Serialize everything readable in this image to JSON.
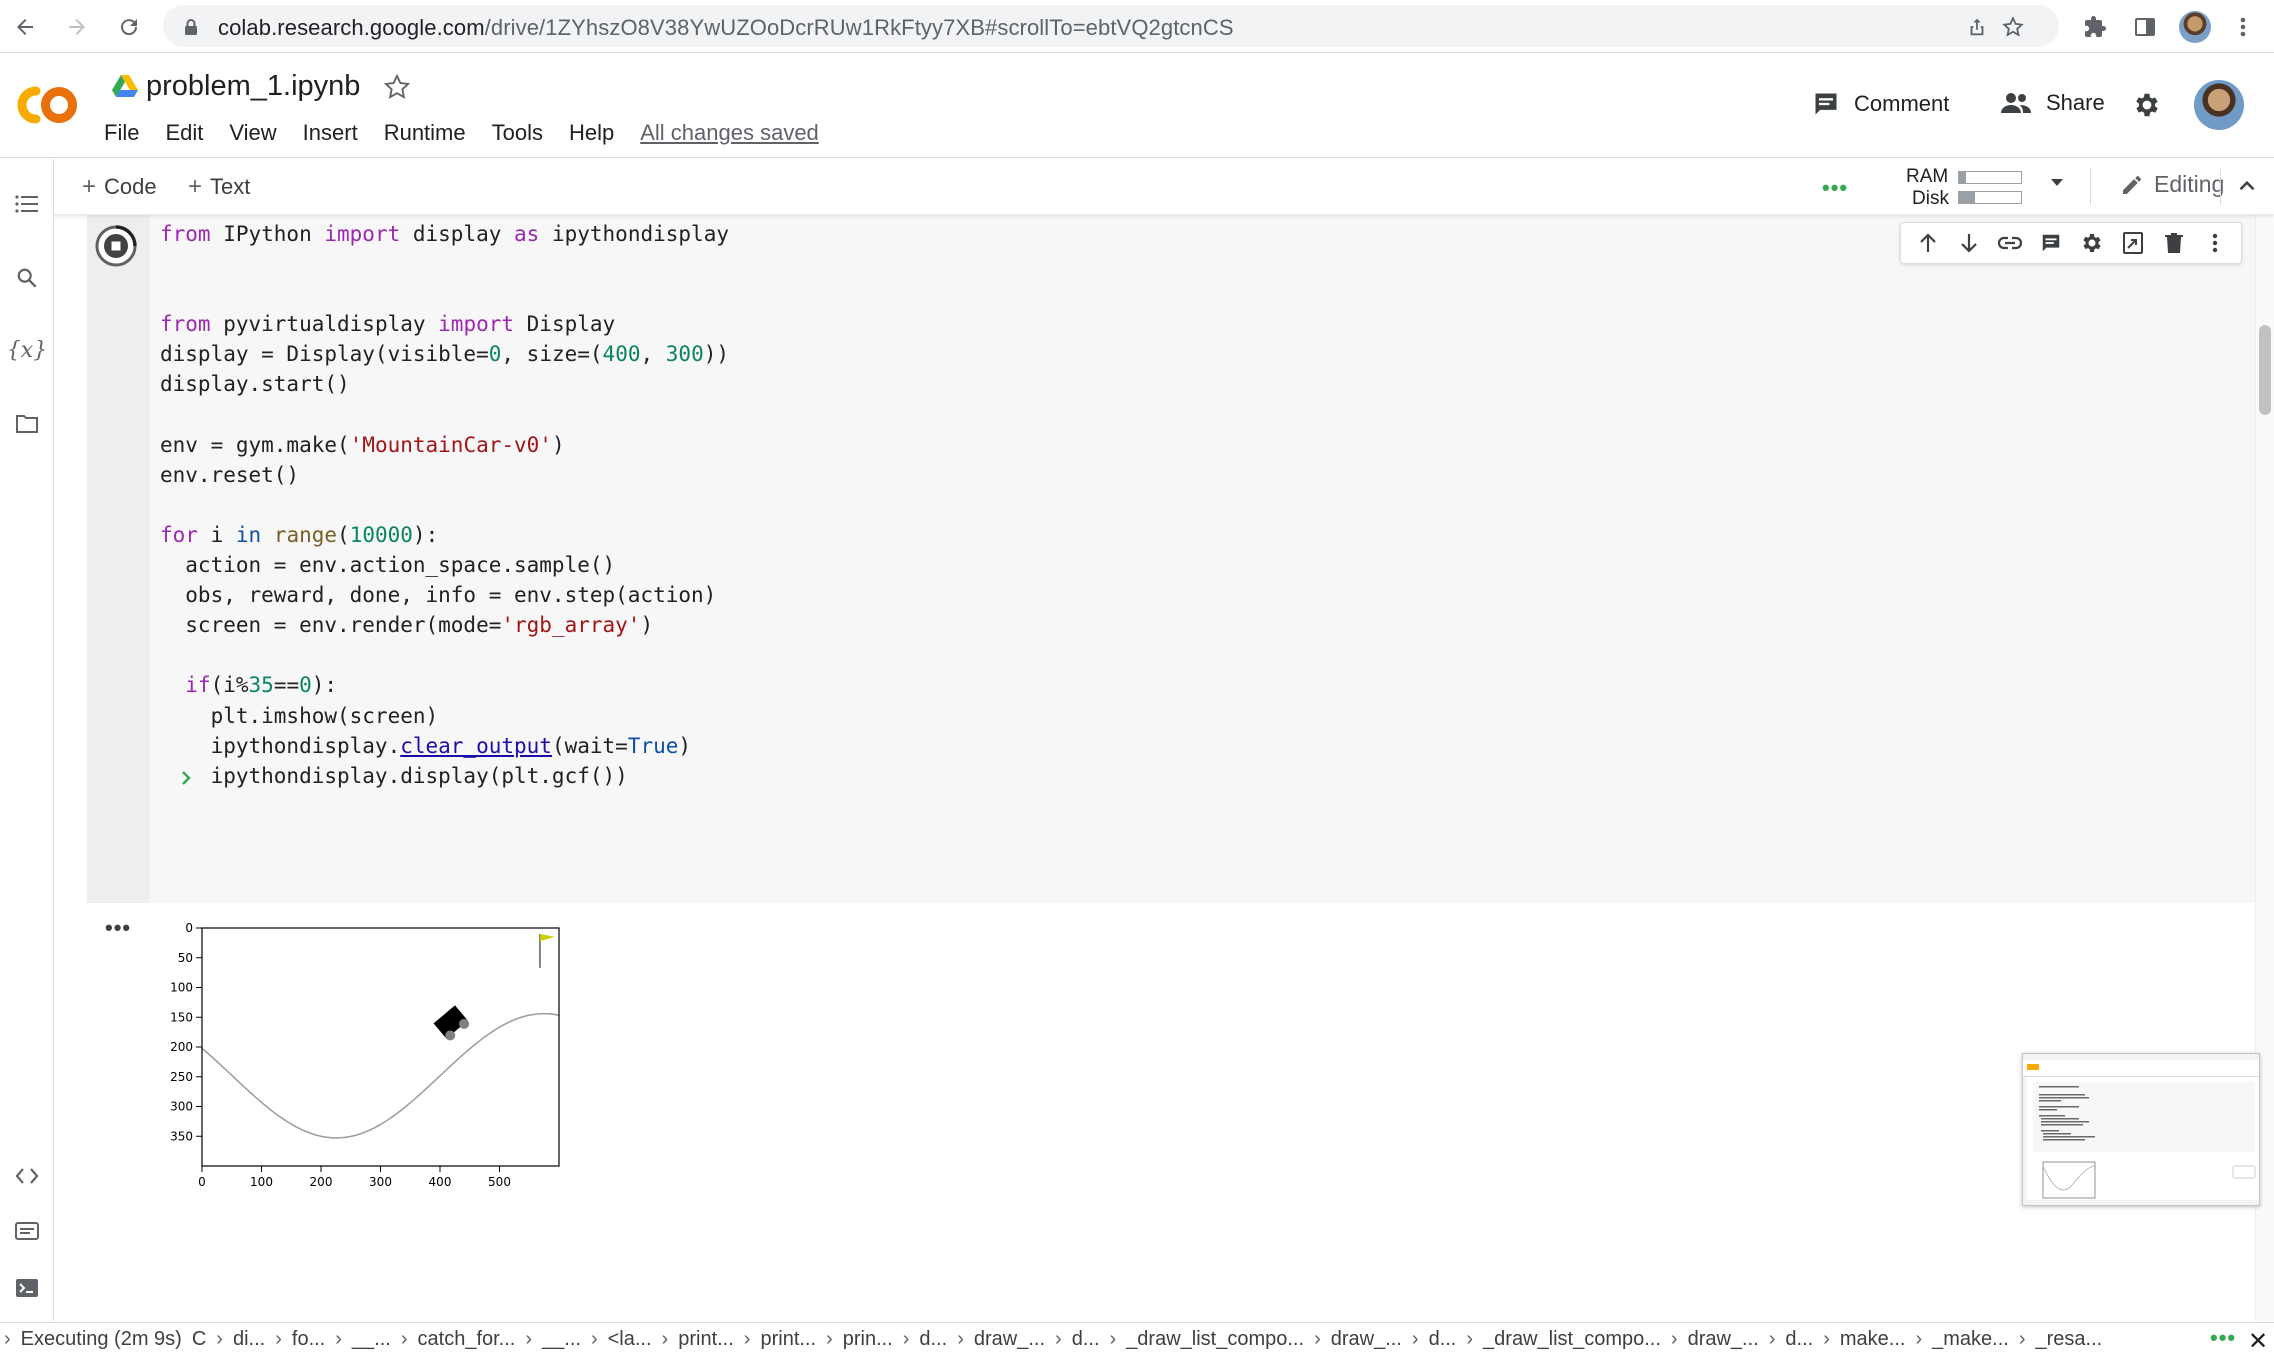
{
  "browser": {
    "url_host": "colab.research.google.com",
    "url_path": "/drive/1ZYhszO8V38YwUZOoDcrRUw1RkFtyy7XB#scrollTo=ebtVQ2gtcnCS"
  },
  "header": {
    "title": "problem_1.ipynb",
    "menu": [
      "File",
      "Edit",
      "View",
      "Insert",
      "Runtime",
      "Tools",
      "Help"
    ],
    "saved_status": "All changes saved",
    "comment_label": "Comment",
    "share_label": "Share"
  },
  "toolbar": {
    "add_code": "Code",
    "add_text": "Text",
    "ram_label": "RAM",
    "disk_label": "Disk",
    "ram_usage": 0.12,
    "disk_usage": 0.25,
    "editing_label": "Editing"
  },
  "cell": {
    "output_menu": "•••"
  },
  "chart_data": {
    "type": "image",
    "x_ticks": [
      "0",
      "100",
      "200",
      "300",
      "400",
      "500"
    ],
    "y_ticks": [
      "0",
      "50",
      "100",
      "150",
      "200",
      "250",
      "300",
      "350"
    ],
    "xlim": [
      0,
      600
    ],
    "ylim": [
      400,
      0
    ],
    "image_width": 600,
    "image_height": 400
  },
  "status": {
    "executing": "Executing (2m 9s)",
    "crumbs": [
      "C",
      "di...",
      "fo...",
      "__...",
      "catch_for...",
      "__...",
      "<la...",
      "print...",
      "print...",
      "prin...",
      "d...",
      "draw_...",
      "d...",
      "_draw_list_compo...",
      "draw_...",
      "d...",
      "_draw_list_compo...",
      "draw_...",
      "d...",
      "make...",
      "_make...",
      "_resa..."
    ],
    "dots": "•••"
  }
}
